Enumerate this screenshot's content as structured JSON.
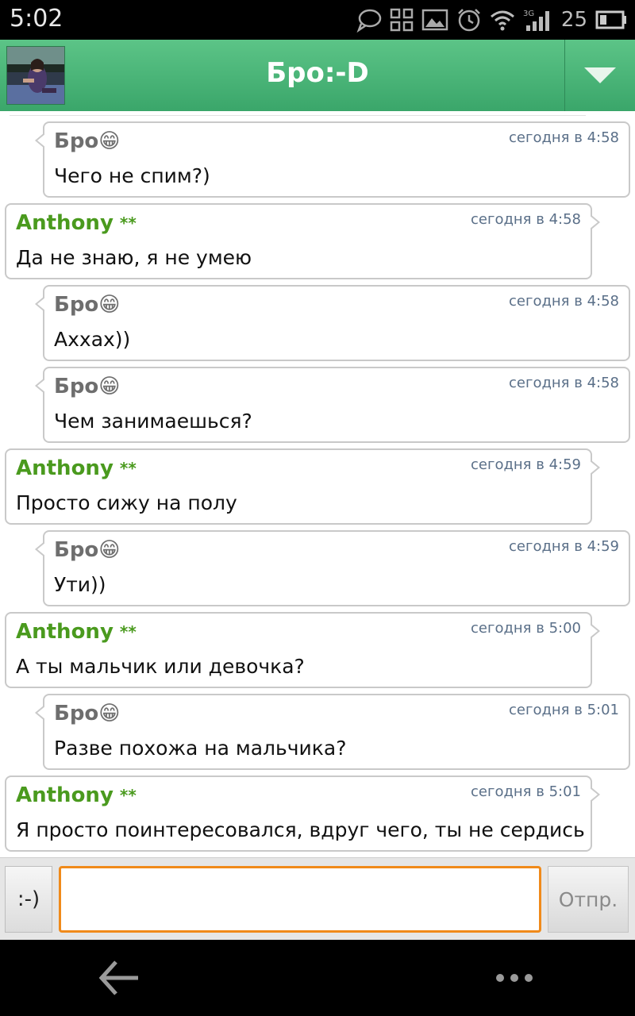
{
  "status_bar": {
    "time": "5:02",
    "battery_level": "25"
  },
  "header": {
    "title": "Бро:-D"
  },
  "messages": [
    {
      "sender": "Бро",
      "emoji": "😁",
      "time": "сегодня в 4:58",
      "text": "Чего не спим?)"
    },
    {
      "sender": "Anthony",
      "badge": "**",
      "time": "сегодня в 4:58",
      "text": "Да не знаю, я не умею"
    },
    {
      "sender": "Бро",
      "emoji": "😁",
      "time": "сегодня в 4:58",
      "text": "Ахxах))"
    },
    {
      "sender": "Бро",
      "emoji": "😁",
      "time": "сегодня в 4:58",
      "text": "Чем занимаешься?"
    },
    {
      "sender": "Anthony",
      "badge": "**",
      "time": "сегодня в 4:59",
      "text": "Просто сижу на полу"
    },
    {
      "sender": "Бро",
      "emoji": "😁",
      "time": "сегодня в 4:59",
      "text": "Ути))"
    },
    {
      "sender": "Anthony",
      "badge": "**",
      "time": "сегодня в 5:00",
      "text": "А ты мальчик или девочка?"
    },
    {
      "sender": "Бро",
      "emoji": "😁",
      "time": "сегодня в 5:01",
      "text": "Разве похожа на мальчика?"
    },
    {
      "sender": "Anthony",
      "badge": "**",
      "time": "сегодня в 5:01",
      "text": "Я просто поинтересовался, вдруг чего, ты не сердись"
    }
  ],
  "composer": {
    "emoji_button": ":-)",
    "input_value": "",
    "send_button": "Отпр."
  },
  "icons": {
    "header_menu": "triangle-down-icon",
    "nav_back": "back-arrow-icon",
    "nav_more": "more-dots-icon"
  },
  "colors": {
    "header_green": "#4cb57a",
    "sender_green": "#4a9a1e",
    "input_border": "#f08a1a"
  }
}
